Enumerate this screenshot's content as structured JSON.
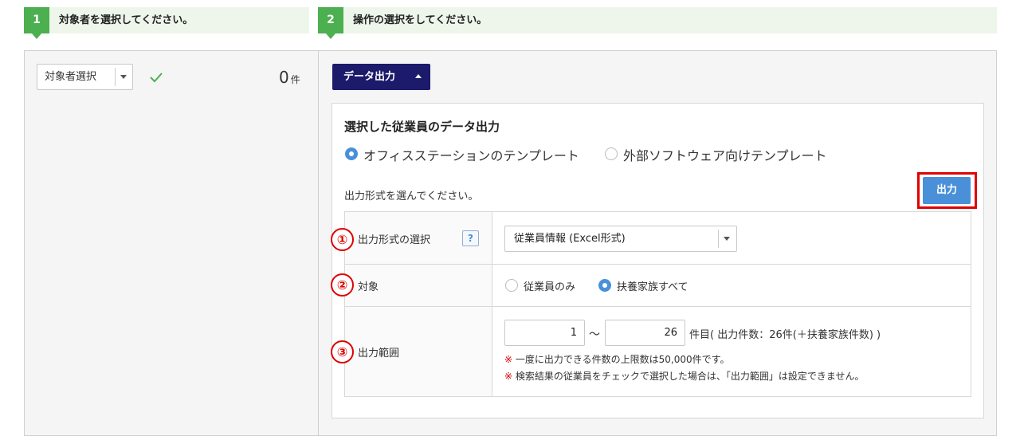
{
  "steps": [
    {
      "num": "1",
      "text": "対象者を選択してください。"
    },
    {
      "num": "2",
      "text": "操作の選択をしてください。"
    }
  ],
  "left": {
    "selector_label": "対象者選択",
    "count_value": "0",
    "count_unit": "件"
  },
  "data_output_button": "データ出力",
  "section": {
    "title": "選択した従業員のデータ出力",
    "template_options": [
      {
        "label": "オフィスステーションのテンプレート",
        "selected": true
      },
      {
        "label": "外部ソフトウェア向けテンプレート",
        "selected": false
      }
    ],
    "prompt": "出力形式を選んでください。",
    "output_button": "出力"
  },
  "table": {
    "rows": [
      {
        "marker": "①",
        "label": "出力形式の選択",
        "help": "?"
      },
      {
        "marker": "②",
        "label": "対象"
      },
      {
        "marker": "③",
        "label": "出力範囲"
      }
    ],
    "format_select_value": "従業員情報 (Excel形式)",
    "target_options": [
      {
        "label": "従業員のみ",
        "selected": false
      },
      {
        "label": "扶養家族すべて",
        "selected": true
      }
    ],
    "range_from": "1",
    "range_tilde": "～",
    "range_to": "26",
    "range_suffix": "件目( 出力件数：26件(＋扶養家族件数) )",
    "note_mark": "※",
    "notes": [
      "一度に出力できる件数の上限数は50,000件です。",
      "検索結果の従業員をチェックで選択した場合は、「出力範囲」は設定できません。"
    ]
  },
  "colors": {
    "step_green": "#4caf50",
    "dark_navy": "#1c1a6b",
    "accent_blue": "#4a90d9",
    "highlight_red": "#e00000"
  }
}
